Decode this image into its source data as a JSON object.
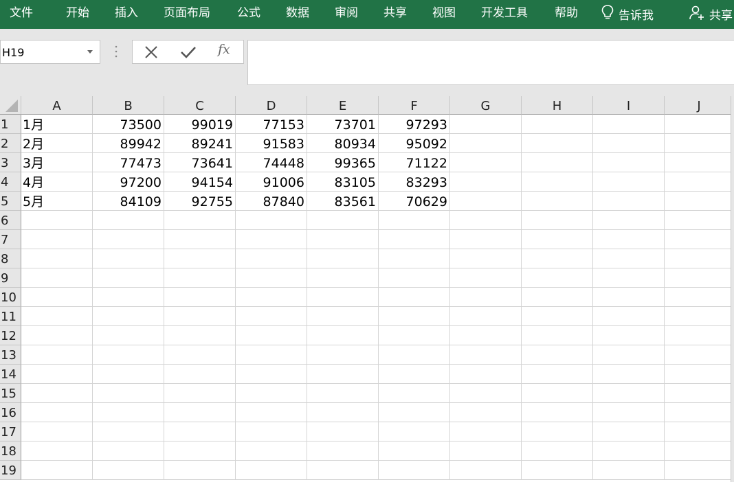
{
  "ribbon": {
    "tabs": [
      "文件",
      "开始",
      "插入",
      "页面布局",
      "公式",
      "数据",
      "审阅",
      "共享",
      "视图",
      "开发工具",
      "帮助"
    ],
    "tell_me": "告诉我",
    "share": "共享",
    "icons": {
      "tell_me": "lightbulb-icon",
      "share": "person-add-icon"
    },
    "color": "#217346"
  },
  "formula_bar": {
    "name_box": "H19",
    "cancel_icon": "close-icon",
    "enter_icon": "checkmark-icon",
    "fx_label": "fx",
    "formula": ""
  },
  "sheet": {
    "columns": [
      "A",
      "B",
      "C",
      "D",
      "E",
      "F",
      "G",
      "H",
      "I",
      "J"
    ],
    "rows": [
      "1",
      "2",
      "3",
      "4",
      "5",
      "6",
      "7",
      "8",
      "9",
      "10",
      "11",
      "12",
      "13",
      "14",
      "15",
      "16",
      "17",
      "18",
      "19"
    ],
    "cells": [
      [
        "1月",
        "73500",
        "99019",
        "77153",
        "73701",
        "97293"
      ],
      [
        "2月",
        "89942",
        "89241",
        "91583",
        "80934",
        "95092"
      ],
      [
        "3月",
        "77473",
        "73641",
        "74448",
        "99365",
        "71122"
      ],
      [
        "4月",
        "97200",
        "94154",
        "91006",
        "83105",
        "83293"
      ],
      [
        "5月",
        "84109",
        "92755",
        "87840",
        "83561",
        "70629"
      ]
    ]
  }
}
